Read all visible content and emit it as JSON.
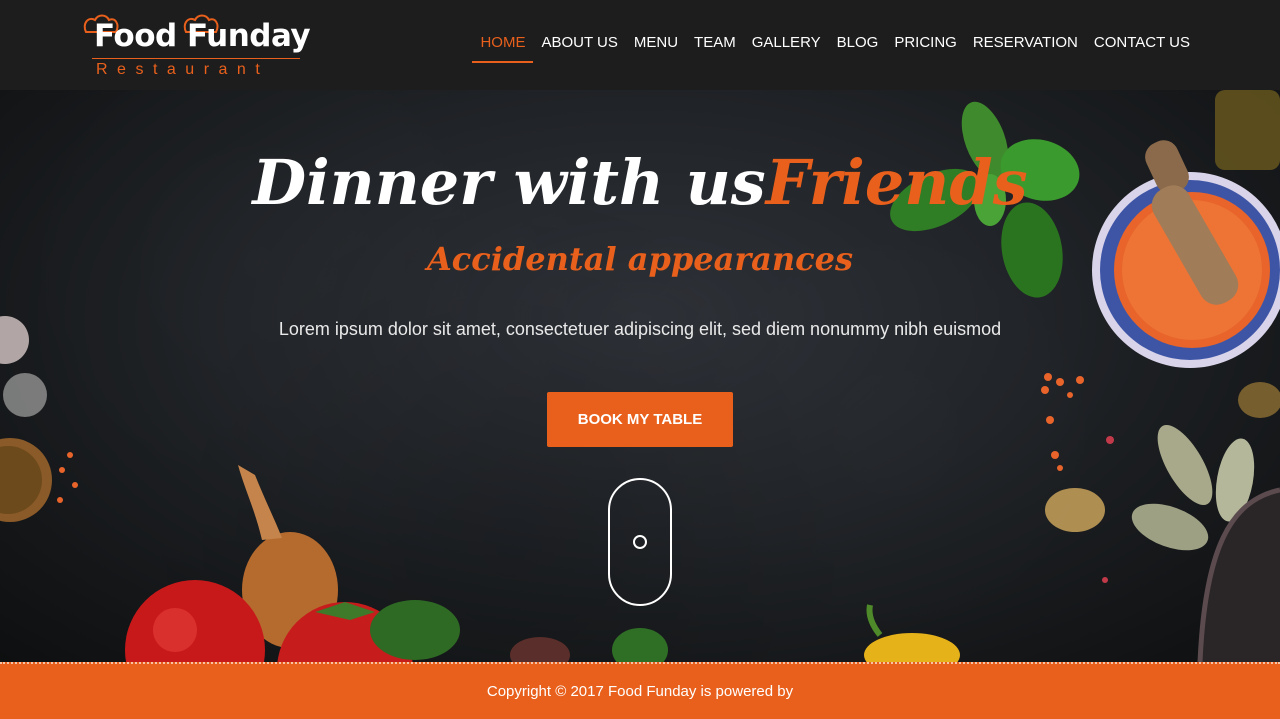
{
  "brand": {
    "name": "Food Funday",
    "tagline": "Restaurant",
    "accent_color": "#e8601c",
    "icon": "chef-hat-icon"
  },
  "nav": {
    "items": [
      {
        "label": "HOME",
        "active": true
      },
      {
        "label": "ABOUT US",
        "active": false
      },
      {
        "label": "MENU",
        "active": false
      },
      {
        "label": "TEAM",
        "active": false
      },
      {
        "label": "GALLERY",
        "active": false
      },
      {
        "label": "BLOG",
        "active": false
      },
      {
        "label": "PRICING",
        "active": false
      },
      {
        "label": "RESERVATION",
        "active": false
      },
      {
        "label": "CONTACT US",
        "active": false
      }
    ]
  },
  "hero": {
    "headline_main": "Dinner with us",
    "headline_accent": "Friends",
    "subheadline": "Accidental appearances",
    "lead": "Lorem ipsum dolor sit amet, consectetuer adipiscing elit, sed diem nonummy nibh euismod",
    "cta_label": "BOOK MY TABLE",
    "scroll_icon": "mouse-scroll-icon"
  },
  "footer": {
    "copyright": "Copyright © 2017 Food Funday is powered by"
  },
  "colors": {
    "header_bg": "#1d1d1d",
    "hero_bg": "#202327",
    "accent": "#e8601c",
    "text": "#ffffff"
  }
}
